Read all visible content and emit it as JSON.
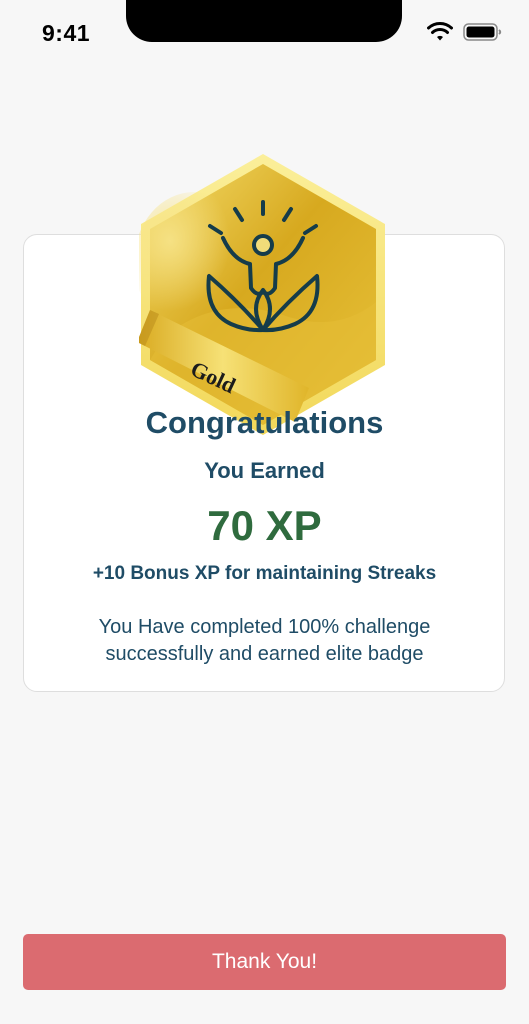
{
  "status_bar": {
    "time": "9:41"
  },
  "badge": {
    "level_label": "Gold",
    "colors": {
      "gold_light": "#f6e27a",
      "gold_mid": "#e5bd2e",
      "gold_dark": "#c49a14",
      "icon_stroke": "#153c4a"
    },
    "icon": "person-with-leaves-icon"
  },
  "card": {
    "title": "Congratulations",
    "earned_label": "You Earned",
    "xp_value": "70 XP",
    "bonus_text": "+10 Bonus XP for maintaining Streaks",
    "description": "You Have completed 100% challenge successfully and earned elite badge"
  },
  "actions": {
    "primary_label": "Thank You!"
  },
  "colors": {
    "heading": "#1f4c66",
    "xp": "#2f6b3e",
    "button": "#db6b70",
    "background": "#f7f7f7"
  }
}
